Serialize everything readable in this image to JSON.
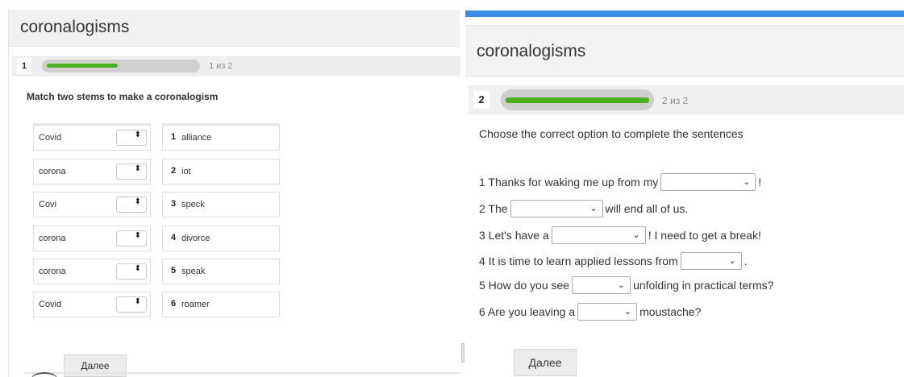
{
  "left": {
    "title": "coronalogisms",
    "question_number": "1",
    "progress_text": "1 из 2",
    "progress_fraction": 0.5,
    "instruction": "Match two stems to make a coronalogism",
    "stems": [
      "Covid",
      "corona",
      "Covi",
      "corona",
      "corona",
      "Covid"
    ],
    "select_arrow": "⬍",
    "matches": [
      {
        "num": "1",
        "word": "alliance"
      },
      {
        "num": "2",
        "word": "iot"
      },
      {
        "num": "3",
        "word": "speck"
      },
      {
        "num": "4",
        "word": "divorce"
      },
      {
        "num": "5",
        "word": "speak"
      },
      {
        "num": "6",
        "word": "roamer"
      }
    ],
    "next_label": "Далее"
  },
  "right": {
    "title": "coronalogisms",
    "question_number": "2",
    "progress_text": "2 из 2",
    "progress_fraction": 1.0,
    "instruction": "Choose the correct option to complete the sentences",
    "chevron": "⌄",
    "sentences": [
      {
        "before": "1 Thanks for waking me up from my",
        "after": "!"
      },
      {
        "before": "2 The",
        "after": "will end all of us."
      },
      {
        "before": "3 Let's have a",
        "after": "! I need to get a break!"
      },
      {
        "before": "4 It is time to learn applied lessons from",
        "after": "."
      },
      {
        "before": "5 How do you see",
        "after": "unfolding in practical terms?"
      },
      {
        "before": "6 Are you leaving a",
        "after": "moustache?"
      }
    ],
    "next_label": "Далее"
  },
  "colors": {
    "accent_blue": "#3a8ce6",
    "progress_green": "#4caf1e",
    "track_gray": "#cfcfcf"
  }
}
